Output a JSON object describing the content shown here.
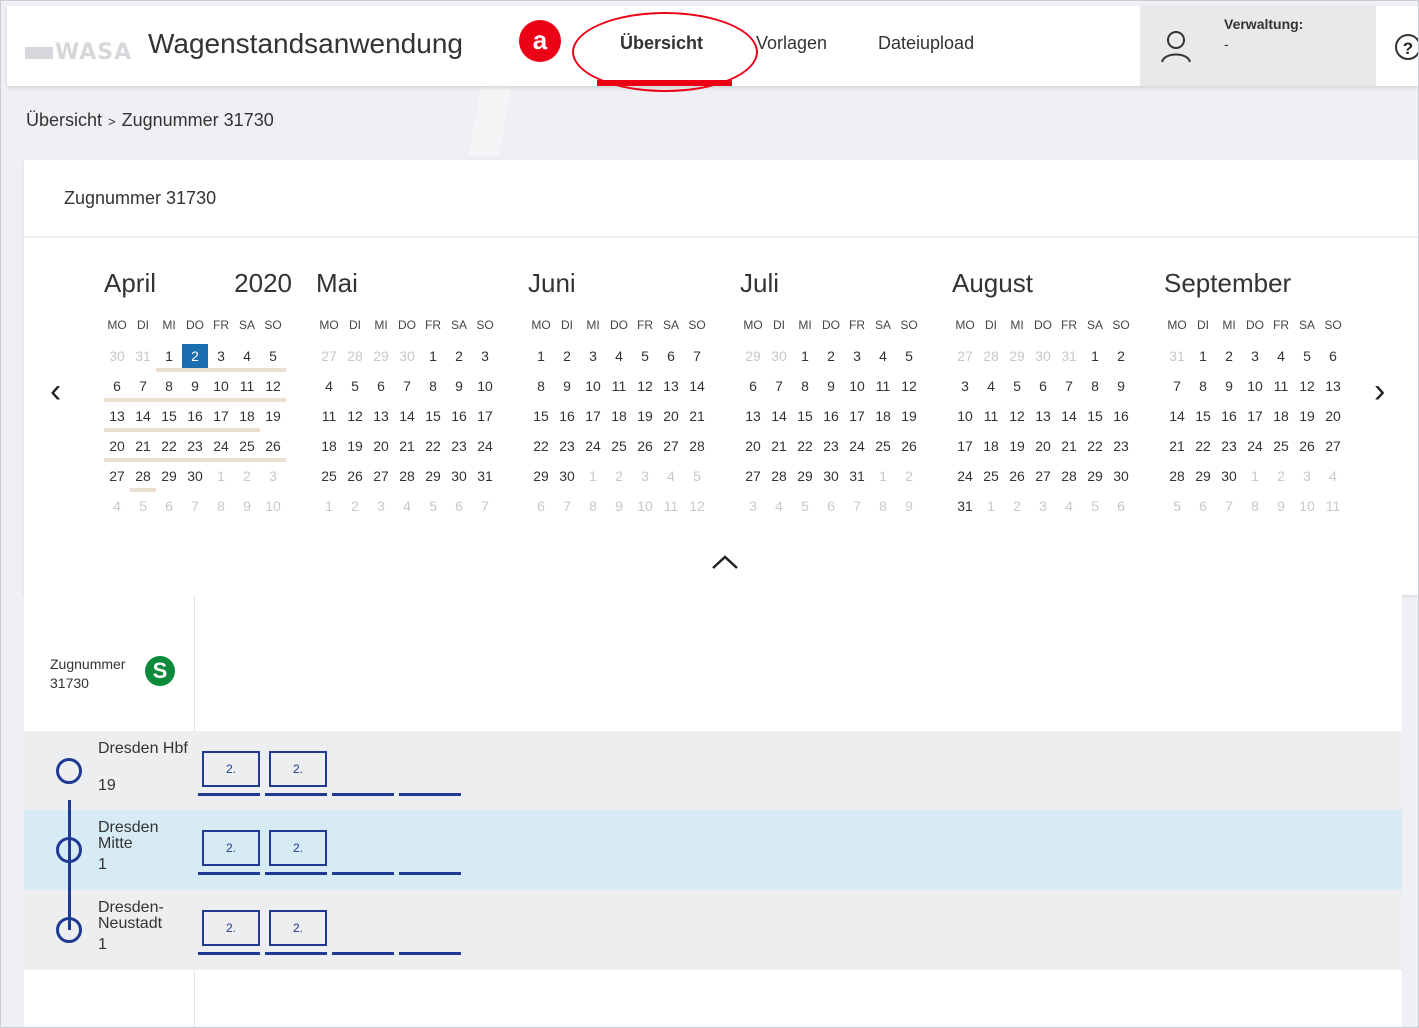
{
  "header": {
    "logo": "WASA",
    "app_title": "Wagenstandsanwendung",
    "nav": [
      {
        "label": "Übersicht"
      },
      {
        "label": "Vorlagen"
      },
      {
        "label": "Dateiupload"
      }
    ],
    "annotation_badge": "a",
    "verwaltung_label": "Verwaltung:",
    "verwaltung_value": "-",
    "help_glyph": "?",
    "accent_color": "#ec0016"
  },
  "breadcrumb": {
    "root": "Übersicht",
    "separator": ">",
    "current": "Zugnummer 31730"
  },
  "calendar": {
    "title": "Zugnummer 31730",
    "year": "2020",
    "weekdays": [
      "MO",
      "DI",
      "MI",
      "DO",
      "FR",
      "SA",
      "SO"
    ],
    "selected_color": "#1a6fb0",
    "months": [
      {
        "name": "April",
        "rows": [
          [
            "30",
            "31",
            "1",
            "2",
            "3",
            "4",
            "5"
          ],
          [
            "6",
            "7",
            "8",
            "9",
            "10",
            "11",
            "12"
          ],
          [
            "13",
            "14",
            "15",
            "16",
            "17",
            "18",
            "19"
          ],
          [
            "20",
            "21",
            "22",
            "23",
            "24",
            "25",
            "26"
          ],
          [
            "27",
            "28",
            "29",
            "30",
            "1",
            "2",
            "3"
          ],
          [
            "4",
            "5",
            "6",
            "7",
            "8",
            "9",
            "10"
          ]
        ],
        "other": [
          [
            0,
            0
          ],
          [
            0,
            1
          ],
          [
            4,
            4
          ],
          [
            4,
            5
          ],
          [
            4,
            6
          ],
          [
            5,
            0
          ],
          [
            5,
            1
          ],
          [
            5,
            2
          ],
          [
            5,
            3
          ],
          [
            5,
            4
          ],
          [
            5,
            5
          ],
          [
            5,
            6
          ]
        ],
        "selected": [
          0,
          3
        ],
        "highlight": [
          [
            0,
            2
          ],
          [
            0,
            3
          ],
          [
            0,
            4
          ],
          [
            0,
            5
          ],
          [
            0,
            6
          ],
          [
            1,
            0
          ],
          [
            1,
            1
          ],
          [
            1,
            2
          ],
          [
            1,
            3
          ],
          [
            1,
            4
          ],
          [
            1,
            5
          ],
          [
            1,
            6
          ],
          [
            2,
            0
          ],
          [
            2,
            1
          ],
          [
            2,
            2
          ],
          [
            2,
            3
          ],
          [
            2,
            4
          ],
          [
            2,
            5
          ],
          [
            3,
            0
          ],
          [
            3,
            1
          ],
          [
            3,
            2
          ],
          [
            3,
            3
          ],
          [
            3,
            4
          ],
          [
            3,
            5
          ],
          [
            3,
            6
          ],
          [
            4,
            1
          ]
        ]
      },
      {
        "name": "Mai",
        "rows": [
          [
            "27",
            "28",
            "29",
            "30",
            "1",
            "2",
            "3"
          ],
          [
            "4",
            "5",
            "6",
            "7",
            "8",
            "9",
            "10"
          ],
          [
            "11",
            "12",
            "13",
            "14",
            "15",
            "16",
            "17"
          ],
          [
            "18",
            "19",
            "20",
            "21",
            "22",
            "23",
            "24"
          ],
          [
            "25",
            "26",
            "27",
            "28",
            "29",
            "30",
            "31"
          ],
          [
            "1",
            "2",
            "3",
            "4",
            "5",
            "6",
            "7"
          ]
        ],
        "other": [
          [
            0,
            0
          ],
          [
            0,
            1
          ],
          [
            0,
            2
          ],
          [
            0,
            3
          ],
          [
            5,
            0
          ],
          [
            5,
            1
          ],
          [
            5,
            2
          ],
          [
            5,
            3
          ],
          [
            5,
            4
          ],
          [
            5,
            5
          ],
          [
            5,
            6
          ]
        ]
      },
      {
        "name": "Juni",
        "rows": [
          [
            "1",
            "2",
            "3",
            "4",
            "5",
            "6",
            "7"
          ],
          [
            "8",
            "9",
            "10",
            "11",
            "12",
            "13",
            "14"
          ],
          [
            "15",
            "16",
            "17",
            "18",
            "19",
            "20",
            "21"
          ],
          [
            "22",
            "23",
            "24",
            "25",
            "26",
            "27",
            "28"
          ],
          [
            "29",
            "30",
            "1",
            "2",
            "3",
            "4",
            "5"
          ],
          [
            "6",
            "7",
            "8",
            "9",
            "10",
            "11",
            "12"
          ]
        ],
        "other": [
          [
            4,
            2
          ],
          [
            4,
            3
          ],
          [
            4,
            4
          ],
          [
            4,
            5
          ],
          [
            4,
            6
          ],
          [
            5,
            0
          ],
          [
            5,
            1
          ],
          [
            5,
            2
          ],
          [
            5,
            3
          ],
          [
            5,
            4
          ],
          [
            5,
            5
          ],
          [
            5,
            6
          ]
        ]
      },
      {
        "name": "Juli",
        "rows": [
          [
            "29",
            "30",
            "1",
            "2",
            "3",
            "4",
            "5"
          ],
          [
            "6",
            "7",
            "8",
            "9",
            "10",
            "11",
            "12"
          ],
          [
            "13",
            "14",
            "15",
            "16",
            "17",
            "18",
            "19"
          ],
          [
            "20",
            "21",
            "22",
            "23",
            "24",
            "25",
            "26"
          ],
          [
            "27",
            "28",
            "29",
            "30",
            "31",
            "1",
            "2"
          ],
          [
            "3",
            "4",
            "5",
            "6",
            "7",
            "8",
            "9"
          ]
        ],
        "other": [
          [
            0,
            0
          ],
          [
            0,
            1
          ],
          [
            4,
            5
          ],
          [
            4,
            6
          ],
          [
            5,
            0
          ],
          [
            5,
            1
          ],
          [
            5,
            2
          ],
          [
            5,
            3
          ],
          [
            5,
            4
          ],
          [
            5,
            5
          ],
          [
            5,
            6
          ]
        ]
      },
      {
        "name": "August",
        "rows": [
          [
            "27",
            "28",
            "29",
            "30",
            "31",
            "1",
            "2"
          ],
          [
            "3",
            "4",
            "5",
            "6",
            "7",
            "8",
            "9"
          ],
          [
            "10",
            "11",
            "12",
            "13",
            "14",
            "15",
            "16"
          ],
          [
            "17",
            "18",
            "19",
            "20",
            "21",
            "22",
            "23"
          ],
          [
            "24",
            "25",
            "26",
            "27",
            "28",
            "29",
            "30"
          ],
          [
            "31",
            "1",
            "2",
            "3",
            "4",
            "5",
            "6"
          ]
        ],
        "other": [
          [
            0,
            0
          ],
          [
            0,
            1
          ],
          [
            0,
            2
          ],
          [
            0,
            3
          ],
          [
            0,
            4
          ],
          [
            5,
            1
          ],
          [
            5,
            2
          ],
          [
            5,
            3
          ],
          [
            5,
            4
          ],
          [
            5,
            5
          ],
          [
            5,
            6
          ]
        ]
      },
      {
        "name": "September",
        "rows": [
          [
            "31",
            "1",
            "2",
            "3",
            "4",
            "5",
            "6"
          ],
          [
            "7",
            "8",
            "9",
            "10",
            "11",
            "12",
            "13"
          ],
          [
            "14",
            "15",
            "16",
            "17",
            "18",
            "19",
            "20"
          ],
          [
            "21",
            "22",
            "23",
            "24",
            "25",
            "26",
            "27"
          ],
          [
            "28",
            "29",
            "30",
            "1",
            "2",
            "3",
            "4"
          ],
          [
            "5",
            "6",
            "7",
            "8",
            "9",
            "10",
            "11"
          ]
        ],
        "other": [
          [
            0,
            0
          ],
          [
            4,
            3
          ],
          [
            4,
            4
          ],
          [
            4,
            5
          ],
          [
            4,
            6
          ],
          [
            5,
            0
          ],
          [
            5,
            1
          ],
          [
            5,
            2
          ],
          [
            5,
            3
          ],
          [
            5,
            4
          ],
          [
            5,
            5
          ],
          [
            5,
            6
          ]
        ]
      }
    ]
  },
  "train": {
    "label": "Zugnummer",
    "number": "31730",
    "badge": "S",
    "badge_color": "#0a8a3a",
    "stations": [
      {
        "name": "Dresden Hbf",
        "track": "19",
        "wagons": [
          "2.",
          "2."
        ]
      },
      {
        "name": "Dresden Mitte",
        "track": "1",
        "wagons": [
          "2.",
          "2."
        ]
      },
      {
        "name": "Dresden-Neustadt",
        "track": "1",
        "wagons": [
          "2.",
          "2."
        ]
      }
    ]
  }
}
